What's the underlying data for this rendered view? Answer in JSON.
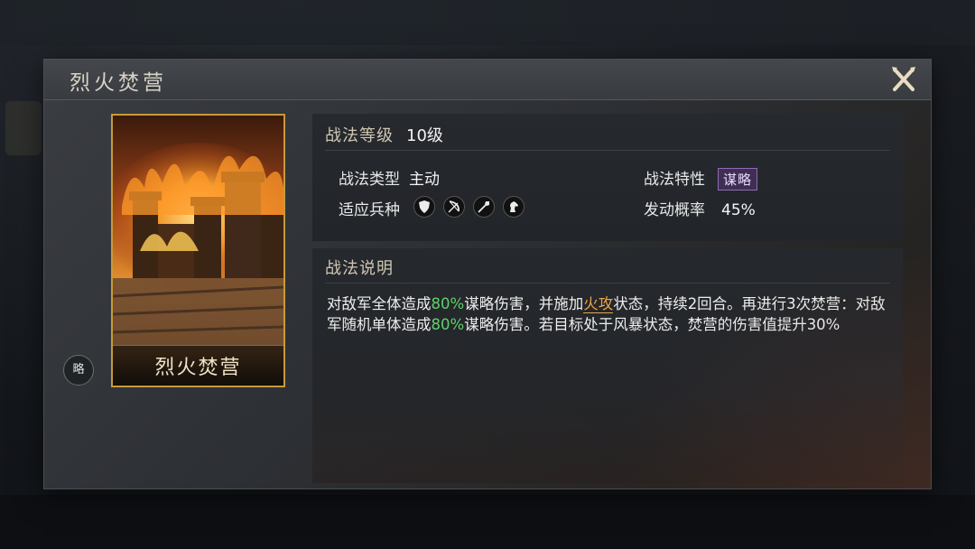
{
  "dialog": {
    "title": "烈火焚营"
  },
  "card": {
    "name": "烈火焚营",
    "strategy_badge": "略",
    "art_icon": "burning-fortress-illustration"
  },
  "info": {
    "level_label": "战法等级",
    "level_value": "10级",
    "type_label": "战法类型",
    "type_value": "主动",
    "trait_label": "战法特性",
    "trait_value": "谋略",
    "troops_label": "适应兵种",
    "troops": [
      "shield-icon",
      "bow-icon",
      "spear-icon",
      "horse-icon"
    ],
    "rate_label": "发动概率",
    "rate_value": "45%"
  },
  "description": {
    "title": "战法说明",
    "p1": "对敌军全体造成",
    "p1_pct": "80%",
    "p2": "谋略伤害，并施加",
    "p2_link": "火攻",
    "p3": "状态，持续2回合。再进行3次焚营：对敌军随机单体造成",
    "p3_pct": "80%",
    "p4": "谋略伤害。若目标处于风暴状态，焚营的伤害值提升30%"
  },
  "colors": {
    "card_border": "#c79a3a",
    "highlight_green": "#5fd06b",
    "highlight_orange": "#e7a548",
    "trait_badge": "#3f2e52"
  }
}
